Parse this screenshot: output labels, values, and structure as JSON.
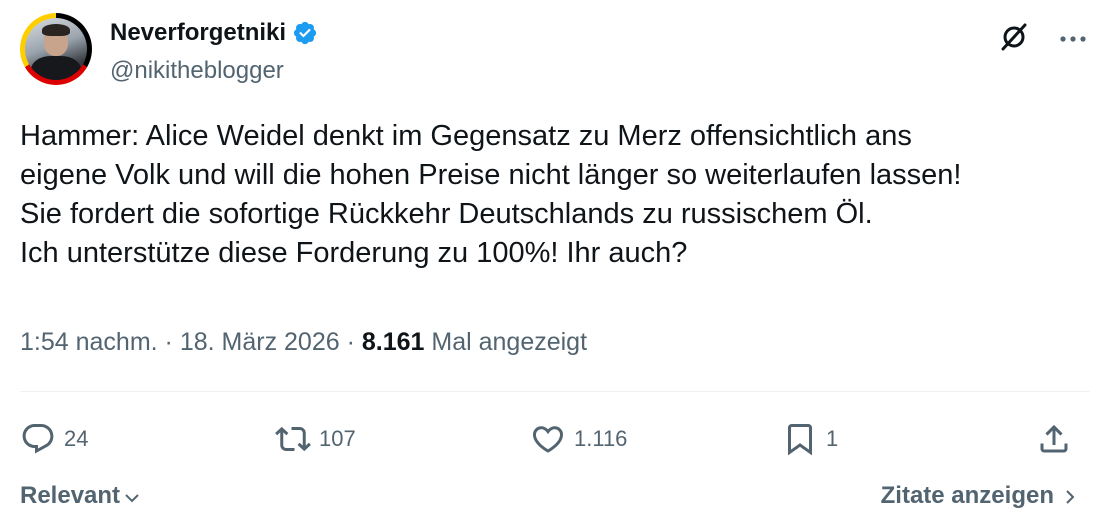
{
  "author": {
    "display_name": "Neverforgetniki",
    "handle": "@nikitheblogger",
    "verified": true,
    "verified_color": "#1d9bf0",
    "avatar_ring_colors": [
      "#000000",
      "#dd0000",
      "#ffce00"
    ]
  },
  "header_icons": {
    "grok": "grok-icon",
    "more": "more-icon"
  },
  "tweet": {
    "lines": [
      "Hammer: Alice Weidel denkt im Gegensatz zu Merz offensichtlich ans",
      "eigene Volk und will die hohen Preise nicht länger so weiterlaufen lassen!",
      "Sie fordert die sofortige Rückkehr Deutschlands zu russischem Öl.",
      "Ich unterstütze diese Forderung zu 100%! Ihr auch?"
    ]
  },
  "meta": {
    "time": "1:54 nachm.",
    "separator": " · ",
    "date": "18. März 2026",
    "views_count": "8.161",
    "views_label": "Mal angezeigt"
  },
  "actions": {
    "replies": "24",
    "reposts": "107",
    "likes": "1.116",
    "bookmarks": "1"
  },
  "footer": {
    "sort_label": "Relevant",
    "quotes_label": "Zitate anzeigen"
  },
  "colors": {
    "text": "#0f1419",
    "secondary": "#536471",
    "divider": "#eff3f4"
  }
}
